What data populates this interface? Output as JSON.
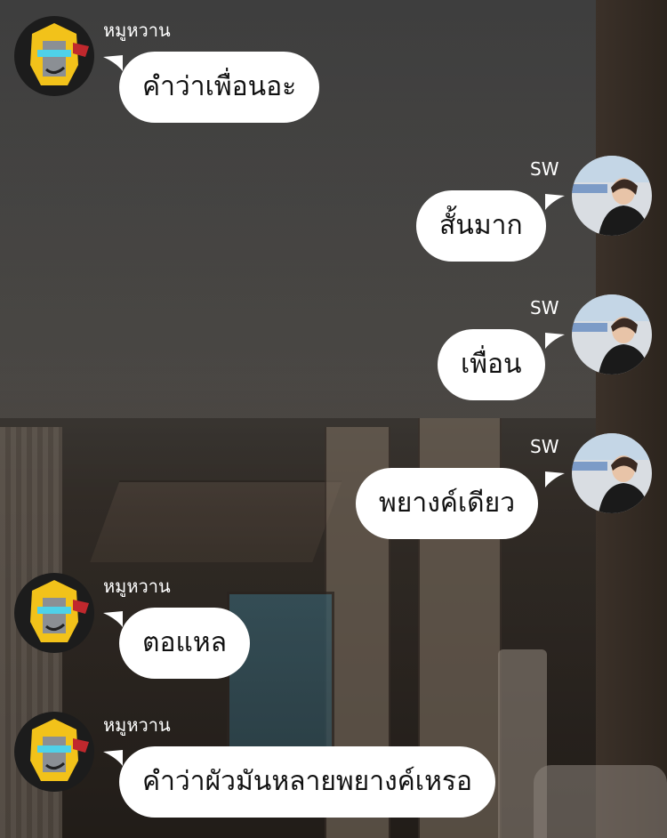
{
  "chat": {
    "participants": {
      "left": {
        "name": "หมูหวาน",
        "avatar_icon": "robot-helmet-avatar-icon"
      },
      "right": {
        "name": "SW",
        "avatar_icon": "person-photo-avatar-icon"
      }
    },
    "messages": [
      {
        "side": "left",
        "sender": "หมูหวาน",
        "text": "คำว่าเพื่อนอะ"
      },
      {
        "side": "right",
        "sender": "SW",
        "text": "สั้นมาก"
      },
      {
        "side": "right",
        "sender": "SW",
        "text": "เพื่อน"
      },
      {
        "side": "right",
        "sender": "SW",
        "text": "พยางค์เดียว"
      },
      {
        "side": "left",
        "sender": "หมูหวาน",
        "text": "ตอแหล"
      },
      {
        "side": "left",
        "sender": "หมูหวาน",
        "text": "คำว่าผัวมันหลายพยางค์เหรอ"
      }
    ]
  },
  "colors": {
    "bubble": "#ffffff",
    "text": "#111111",
    "name": "#ffffff",
    "robot_yellow": "#f2c21a"
  }
}
